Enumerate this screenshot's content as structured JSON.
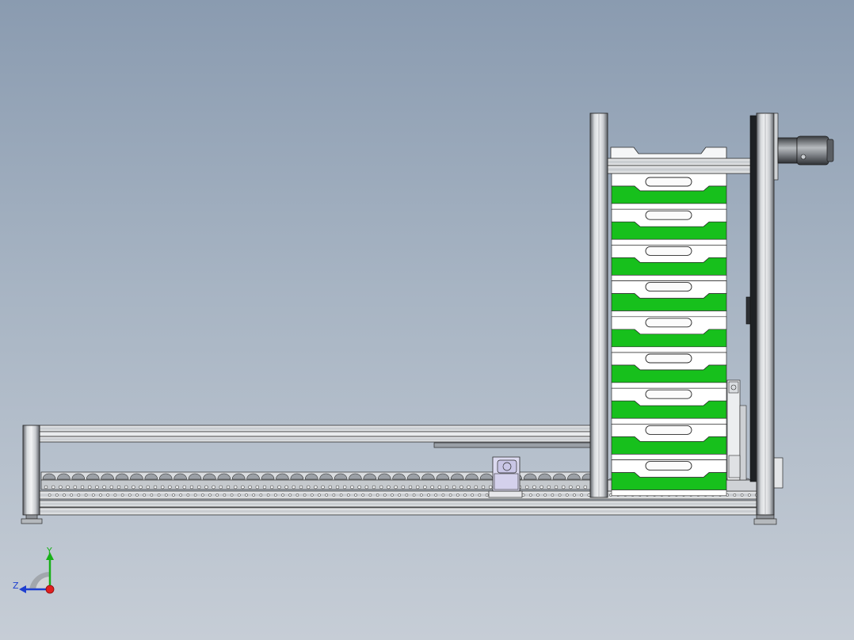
{
  "viewport": {
    "background_top": "#8a9bb0",
    "background_bottom": "#c6cdd6"
  },
  "colors": {
    "tray_green": "#17c01c",
    "tray_white": "#ffffff",
    "frame_light": "#e4e7ea",
    "frame_dark": "#6c7076",
    "outline": "#2a2a2a",
    "axis_x": "#e02020",
    "axis_y": "#18b018",
    "axis_z": "#1e3fd0"
  },
  "model": {
    "tray_count": 9,
    "roller_count": 38
  },
  "triad": {
    "y_label": "Y",
    "z_label": "Z"
  }
}
